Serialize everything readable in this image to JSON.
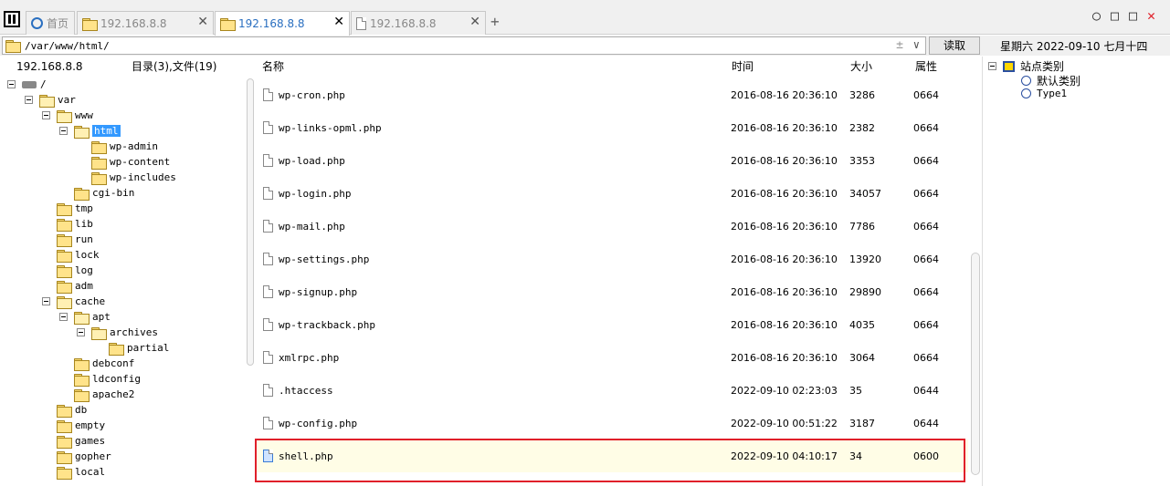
{
  "tabs": [
    {
      "label": "首页",
      "icon": "home-icon",
      "active": false
    },
    {
      "label": "192.168.8.8",
      "icon": "folder-icon",
      "active": false
    },
    {
      "label": "192.168.8.8",
      "icon": "folder-icon",
      "active": true
    },
    {
      "label": "192.168.8.8",
      "icon": "document-icon",
      "active": false
    }
  ],
  "window_controls": {
    "minimize": "○",
    "maximize": "□",
    "close": "✕"
  },
  "address": {
    "path": "/var/www/html/",
    "read_label": "读取",
    "plusminus": "±",
    "dropdown": "∨"
  },
  "date_text": "星期六 2022-09-10 七月十四",
  "tree_header": {
    "host": "192.168.8.8",
    "summary": "目录(3),文件(19)"
  },
  "columns": {
    "name": "名称",
    "time": "时间",
    "size": "大小",
    "attr": "属性"
  },
  "tree": [
    {
      "name": "/",
      "level": 0,
      "expanded": true,
      "type": "drive"
    },
    {
      "name": "var",
      "level": 1,
      "expanded": true
    },
    {
      "name": "www",
      "level": 2,
      "expanded": true
    },
    {
      "name": "html",
      "level": 3,
      "expanded": true,
      "selected": true
    },
    {
      "name": "wp-admin",
      "level": 4
    },
    {
      "name": "wp-content",
      "level": 4
    },
    {
      "name": "wp-includes",
      "level": 4
    },
    {
      "name": "cgi-bin",
      "level": 3
    },
    {
      "name": "tmp",
      "level": 2
    },
    {
      "name": "lib",
      "level": 2
    },
    {
      "name": "run",
      "level": 2
    },
    {
      "name": "lock",
      "level": 2
    },
    {
      "name": "log",
      "level": 2
    },
    {
      "name": "adm",
      "level": 2
    },
    {
      "name": "cache",
      "level": 2,
      "expanded": true
    },
    {
      "name": "apt",
      "level": 3,
      "expanded": true
    },
    {
      "name": "archives",
      "level": 4,
      "expanded": true
    },
    {
      "name": "partial",
      "level": 5
    },
    {
      "name": "debconf",
      "level": 3
    },
    {
      "name": "ldconfig",
      "level": 3
    },
    {
      "name": "apache2",
      "level": 3
    },
    {
      "name": "db",
      "level": 2
    },
    {
      "name": "empty",
      "level": 2
    },
    {
      "name": "games",
      "level": 2
    },
    {
      "name": "gopher",
      "level": 2
    },
    {
      "name": "local",
      "level": 2
    }
  ],
  "files": [
    {
      "name": "wp-cron.php",
      "time": "2016-08-16 20:36:10",
      "size": "3286",
      "attr": "0664"
    },
    {
      "name": "wp-links-opml.php",
      "time": "2016-08-16 20:36:10",
      "size": "2382",
      "attr": "0664"
    },
    {
      "name": "wp-load.php",
      "time": "2016-08-16 20:36:10",
      "size": "3353",
      "attr": "0664"
    },
    {
      "name": "wp-login.php",
      "time": "2016-08-16 20:36:10",
      "size": "34057",
      "attr": "0664"
    },
    {
      "name": "wp-mail.php",
      "time": "2016-08-16 20:36:10",
      "size": "7786",
      "attr": "0664"
    },
    {
      "name": "wp-settings.php",
      "time": "2016-08-16 20:36:10",
      "size": "13920",
      "attr": "0664"
    },
    {
      "name": "wp-signup.php",
      "time": "2016-08-16 20:36:10",
      "size": "29890",
      "attr": "0664"
    },
    {
      "name": "wp-trackback.php",
      "time": "2016-08-16 20:36:10",
      "size": "4035",
      "attr": "0664"
    },
    {
      "name": "xmlrpc.php",
      "time": "2016-08-16 20:36:10",
      "size": "3064",
      "attr": "0664"
    },
    {
      "name": ".htaccess",
      "time": "2022-09-10 02:23:03",
      "size": "35",
      "attr": "0644"
    },
    {
      "name": "wp-config.php",
      "time": "2022-09-10 00:51:22",
      "size": "3187",
      "attr": "0644"
    },
    {
      "name": "shell.php",
      "time": "2022-09-10 04:10:17",
      "size": "34",
      "attr": "0600",
      "highlighted": true
    }
  ],
  "site_categories": {
    "root": "站点类别",
    "items": [
      "默认类别",
      "Type1"
    ]
  },
  "colors": {
    "highlight_box": "#e0202a",
    "selection": "#3399ff",
    "active_tab_text": "#2a6fc0"
  }
}
